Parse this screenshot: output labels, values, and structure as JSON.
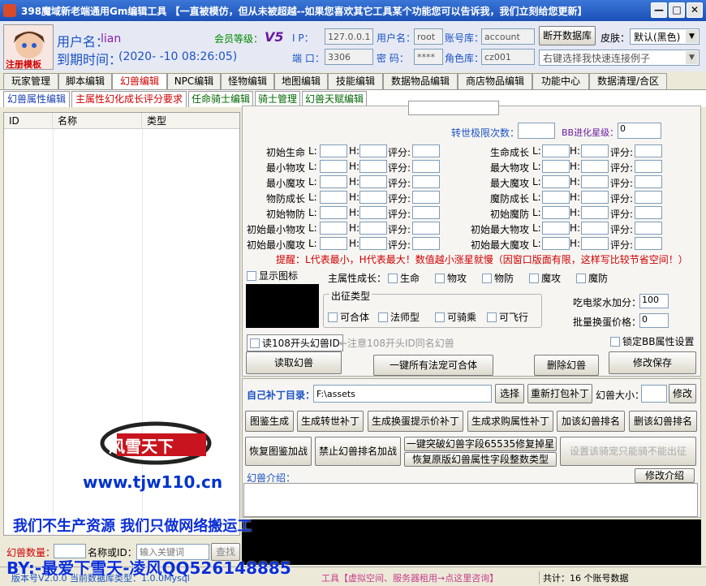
{
  "window": {
    "title": "398魔域新老端通用Gm编辑工具 【一直被模仿，但从未被超越--如果您喜欢其它工具某个功能您可以告诉我，我们立刻给您更新】",
    "min": "—",
    "max": "□",
    "close": "✕"
  },
  "header": {
    "avatar_caption": "注册模板",
    "username_label": "用户名：",
    "username_value": "lian",
    "expiry_label": "到期时间：",
    "expiry_value": "(2020-  -10 08:26:05)",
    "member_label": "会员等级：",
    "member_value": "V5",
    "ip_label": "I    P：",
    "ip_value": "127.0.0.1",
    "port_label": "端 口：",
    "port_value": "3306",
    "user_label": "用户名：",
    "user_value": "root",
    "pwd_label": "密   码：",
    "pwd_value": "****",
    "acctdb_label": "账号库：",
    "acctdb_value": "account",
    "roledb_label": "角色库：",
    "roledb_value": "cz001",
    "disconnect": "断开数据库",
    "skin_label": "皮肤：",
    "skin_value": "默认(黑色)",
    "quick_connect": "右键选择我快速连接例子"
  },
  "main_tabs": [
    "玩家管理",
    "脚本编辑",
    "幻兽编辑",
    "NPC编辑",
    "怪物编辑",
    "地图编辑",
    "技能编辑",
    "数据物品编辑",
    "商店物品编辑",
    "功能中心",
    "数据清理/合区"
  ],
  "sub_tabs": [
    "幻兽属性编辑",
    "主属性幻化成长评分要求",
    "任命骑士编辑",
    "骑士管理",
    "幻兽天赋编辑"
  ],
  "list": {
    "columns": [
      "ID",
      "名称",
      "类型"
    ]
  },
  "form": {
    "rebirth_label": "转世极限次数：",
    "bb_label": "BB进化星级：",
    "bb_value": "0",
    "left_fields": [
      "初始生命",
      "最小物攻",
      "最小魔攻",
      "物防成长",
      "初始物防",
      "初始最小物攻",
      "初始最小魔攻"
    ],
    "right_fields": [
      "生命成长",
      "最大物攻",
      "最大魔攻",
      "魔防成长",
      "初始魔防",
      "初始最大物攻",
      "初始最大魔攻"
    ],
    "l_label": "L:",
    "h_label": "H:",
    "score_label": "评分:",
    "tip": "提醒：L代表最小，H代表最大！数值越小涨星就慢（因窗口版面有限，这样写比较节省空间！）",
    "show_icon": "显示图标",
    "main_attr_label": "主属性成长：",
    "main_attrs": [
      "生命",
      "物攻",
      "物防",
      "魔攻",
      "魔防"
    ],
    "expedition_label": "出征类型",
    "expedition_opts": [
      "可合体",
      "法师型",
      "可骑乘",
      "可飞行"
    ],
    "eat_label": "吃电浆水加分：",
    "eat_value": "100",
    "batch_label": "批量换蛋价格：",
    "batch_value": "0",
    "read108": "读108开头幻兽ID",
    "read108_note": "←注意108开头ID同名幻兽",
    "lock_bb": "锁定BB属性设置",
    "read_btn": "读取幻兽",
    "merge_btn": "一键所有法宠可合体",
    "delete_btn": "删除幻兽",
    "save_btn": "修改保存"
  },
  "patch": {
    "dir_label": "自己补丁目录：",
    "dir_value": "F:\\assets",
    "choose": "选择",
    "repack": "重新打包补丁",
    "size_label": "幻兽大小：",
    "size_modify": "修改",
    "row1": [
      "图鉴生成",
      "生成转世补丁",
      "生成换蛋提示价补丁",
      "生成求购属性补丁",
      "加该幻兽排名",
      "删该幻兽排名"
    ],
    "restore_icon": "恢复图鉴加战",
    "ban_rank": "禁止幻兽排名加战",
    "break_field": "一键突破幻兽字段65535修复掉星",
    "restore_field": "恢复原版幻兽属性字段整数类型",
    "no_ride": "设置该骑宠只能骑不能出征",
    "intro_label": "幻兽介绍：",
    "intro_modify": "修改介绍"
  },
  "bottom": {
    "count_label": "幻兽数量：",
    "search_label": "名称或ID：",
    "search_placeholder": "输入关键词",
    "search_btn": "查找",
    "status_left": "版本号V2.0.0  当前数据库类型：1.0.0Mysql",
    "status_ad": "工具【虚拟空间、服务器租用→点这里咨询】",
    "status_total": "共计：16 个账号数据"
  },
  "overlays": {
    "site": "www.tjw110.cn",
    "logo_text": "风雪天下",
    "slogan": "我们不生产资源 我们只做网络搬运工",
    "by": "BY:-最爱下雪天-凌风QQ526148885"
  }
}
